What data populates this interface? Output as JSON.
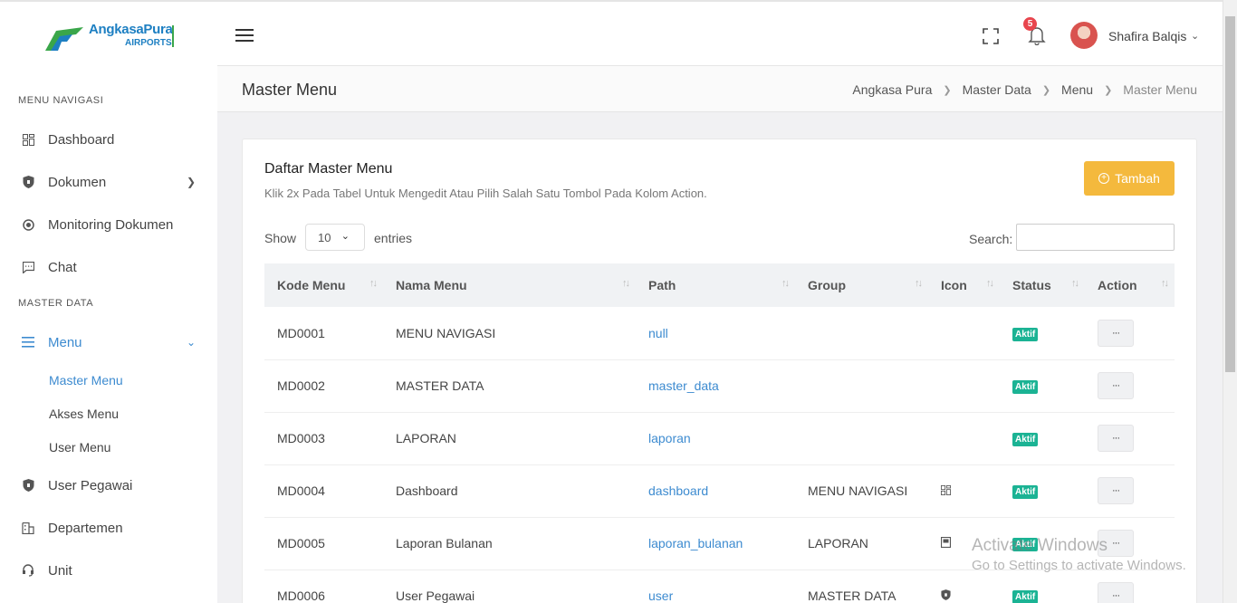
{
  "brand": {
    "line1": "AngkasaPura",
    "line2": "AIRPORTS"
  },
  "sidebar": {
    "section1": "MENU NAVIGASI",
    "section2": "MASTER DATA",
    "items": [
      {
        "label": "Dashboard",
        "icon": "dashboard-icon"
      },
      {
        "label": "Dokumen",
        "icon": "shield-icon"
      },
      {
        "label": "Monitoring Dokumen",
        "icon": "target-icon"
      },
      {
        "label": "Chat",
        "icon": "chat-icon"
      },
      {
        "label": "Menu",
        "icon": "list-icon"
      },
      {
        "label": "User Pegawai",
        "icon": "shield-icon"
      },
      {
        "label": "Departemen",
        "icon": "building-icon"
      },
      {
        "label": "Unit",
        "icon": "headset-icon"
      }
    ],
    "submenu": [
      "Master Menu",
      "Akses Menu",
      "User Menu"
    ]
  },
  "topbar": {
    "notification_count": "5",
    "user_name": "Shafira Balqis"
  },
  "page": {
    "title": "Master Menu",
    "breadcrumb": [
      "Angkasa Pura",
      "Master Data",
      "Menu",
      "Master Menu"
    ]
  },
  "card": {
    "title": "Daftar Master Menu",
    "subtitle": "Klik 2x Pada Tabel Untuk Mengedit Atau Pilih Salah Satu Tombol Pada Kolom Action.",
    "add_label": "Tambah",
    "show_label": "Show",
    "entries_value": "10",
    "entries_label": "entries",
    "search_label": "Search:"
  },
  "table": {
    "headers": [
      "Kode Menu",
      "Nama Menu",
      "Path",
      "Group",
      "Icon",
      "Status",
      "Action"
    ],
    "rows": [
      {
        "kode": "MD0001",
        "nama": "MENU NAVIGASI",
        "path": "null",
        "group": "",
        "icon": "",
        "status": "Aktif"
      },
      {
        "kode": "MD0002",
        "nama": "MASTER DATA",
        "path": "master_data",
        "group": "",
        "icon": "",
        "status": "Aktif"
      },
      {
        "kode": "MD0003",
        "nama": "LAPORAN",
        "path": "laporan",
        "group": "",
        "icon": "",
        "status": "Aktif"
      },
      {
        "kode": "MD0004",
        "nama": "Dashboard",
        "path": "dashboard",
        "group": "MENU NAVIGASI",
        "icon": "dashboard-icon",
        "status": "Aktif"
      },
      {
        "kode": "MD0005",
        "nama": "Laporan Bulanan",
        "path": "laporan_bulanan",
        "group": "LAPORAN",
        "icon": "book-icon",
        "status": "Aktif"
      },
      {
        "kode": "MD0006",
        "nama": "User Pegawai",
        "path": "user",
        "group": "MASTER DATA",
        "icon": "shield-icon",
        "status": "Aktif"
      }
    ],
    "action_label": "···"
  },
  "watermark": {
    "line1": "Activate Windows",
    "line2": "Go to Settings to activate Windows."
  }
}
